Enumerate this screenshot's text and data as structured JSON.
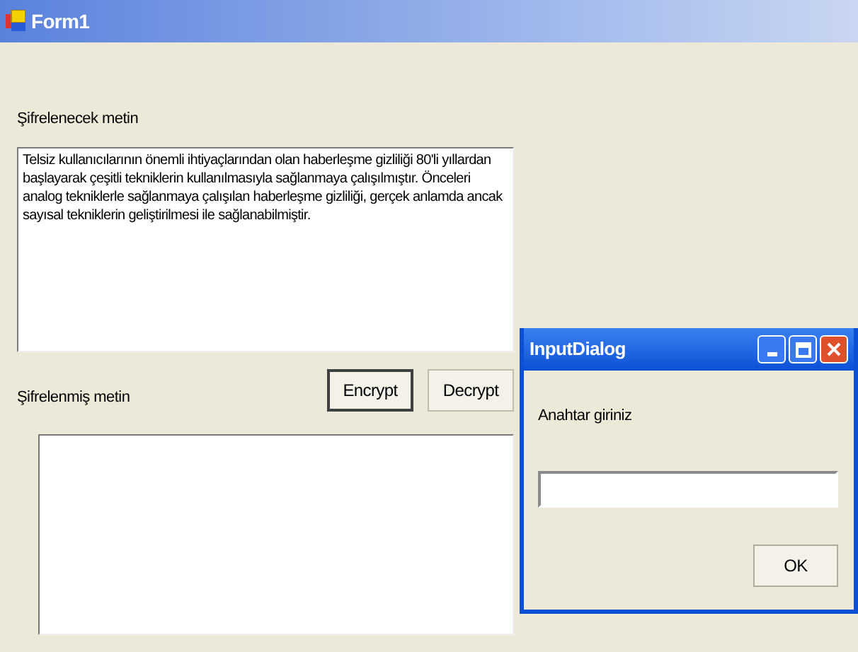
{
  "window": {
    "title": "Form1"
  },
  "source_label": "Şifrelenecek metin",
  "source_text": "Telsiz kullanıcılarının önemli ihtiyaçlarından olan haberleşme gizliliği 80'li yıllardan başlayarak çeşitli tekniklerin kullanılmasıyla sağlanmaya çalışılmıştır. Önceleri analog tekniklerle sağlanmaya çalışılan haberleşme gizliliği, gerçek anlamda ancak sayısal tekniklerin geliştirilmesi ile sağlanabilmiştir.",
  "buttons": [
    {
      "label": "Encrypt",
      "focused": true
    },
    {
      "label": "Decrypt",
      "focused": false
    }
  ],
  "result_label": "Şifrelenmiş metin",
  "dialog": {
    "title": "InputDialog",
    "prompt": "Anahtar giriniz",
    "button": "OK"
  }
}
